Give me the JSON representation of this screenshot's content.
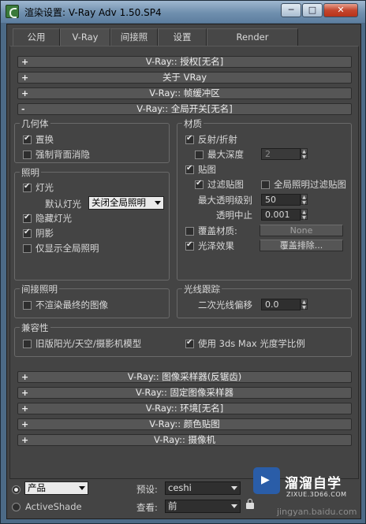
{
  "window": {
    "title": "渲染设置: V-Ray Adv 1.50.SP4",
    "minimize": "─",
    "maximize": "□",
    "close": "✕"
  },
  "tabs": [
    "公用",
    "V-Ray",
    "间接照明",
    "设置",
    "Render Elements"
  ],
  "rollouts_top": [
    {
      "sign": "+",
      "label": "V-Ray:: 授权[无名]"
    },
    {
      "sign": "+",
      "label": "关于 VRay"
    },
    {
      "sign": "+",
      "label": "V-Ray:: 帧缓冲区"
    },
    {
      "sign": "-",
      "label": "V-Ray:: 全局开关[无名]"
    }
  ],
  "geometry": {
    "title": "几何体",
    "displacement": "置换",
    "force_backface": "强制背面消隐"
  },
  "lighting": {
    "title": "照明",
    "lights": "灯光",
    "default_lights_label": "默认灯光",
    "default_lights_value": "关闭全局照明",
    "hidden_lights": "隐藏灯光",
    "shadows": "阴影",
    "show_gi_only": "仅显示全局照明"
  },
  "indirect": {
    "title": "间接照明",
    "dont_render_final": "不渲染最终的图像"
  },
  "materials": {
    "title": "材质",
    "reflection": "反射/折射",
    "max_depth": "最大深度",
    "max_depth_value": "2",
    "maps": "贴图",
    "filter_maps": "过滤贴图",
    "gi_filter_maps": "全局照明过滤贴图",
    "max_transp_label": "最大透明级别",
    "max_transp_value": "50",
    "transp_cutoff_label": "透明中止",
    "transp_cutoff_value": "0.001",
    "override_mtl": "覆盖材质:",
    "override_value": "None",
    "glossy": "光泽效果",
    "override_exclude": "覆盖排除..."
  },
  "raytracing": {
    "title": "光线跟踪",
    "secondary_bias_label": "二次光线偏移",
    "secondary_bias_value": "0.0"
  },
  "compat": {
    "title": "兼容性",
    "legacy_sun": "旧版阳光/天空/摄影机模型",
    "use_3dsmax": "使用 3ds Max 光度学比例"
  },
  "rollouts_bottom": [
    {
      "sign": "+",
      "label": "V-Ray:: 图像采样器(反锯齿)"
    },
    {
      "sign": "+",
      "label": "V-Ray:: 固定图像采样器"
    },
    {
      "sign": "+",
      "label": "V-Ray:: 环境[无名]"
    },
    {
      "sign": "+",
      "label": "V-Ray:: 颜色贴图"
    },
    {
      "sign": "+",
      "label": "V-Ray:: 摄像机"
    }
  ],
  "bottom": {
    "mode_production": "产品",
    "mode_activeshade": "ActiveShade",
    "preset_label": "预设:",
    "preset_value": "ceshi",
    "view_label": "查看:",
    "view_value": "前"
  },
  "watermark": {
    "name": "溜溜自学",
    "url": "ZIXUE.3D66.COM",
    "site": "jingyan.baidu.com"
  }
}
